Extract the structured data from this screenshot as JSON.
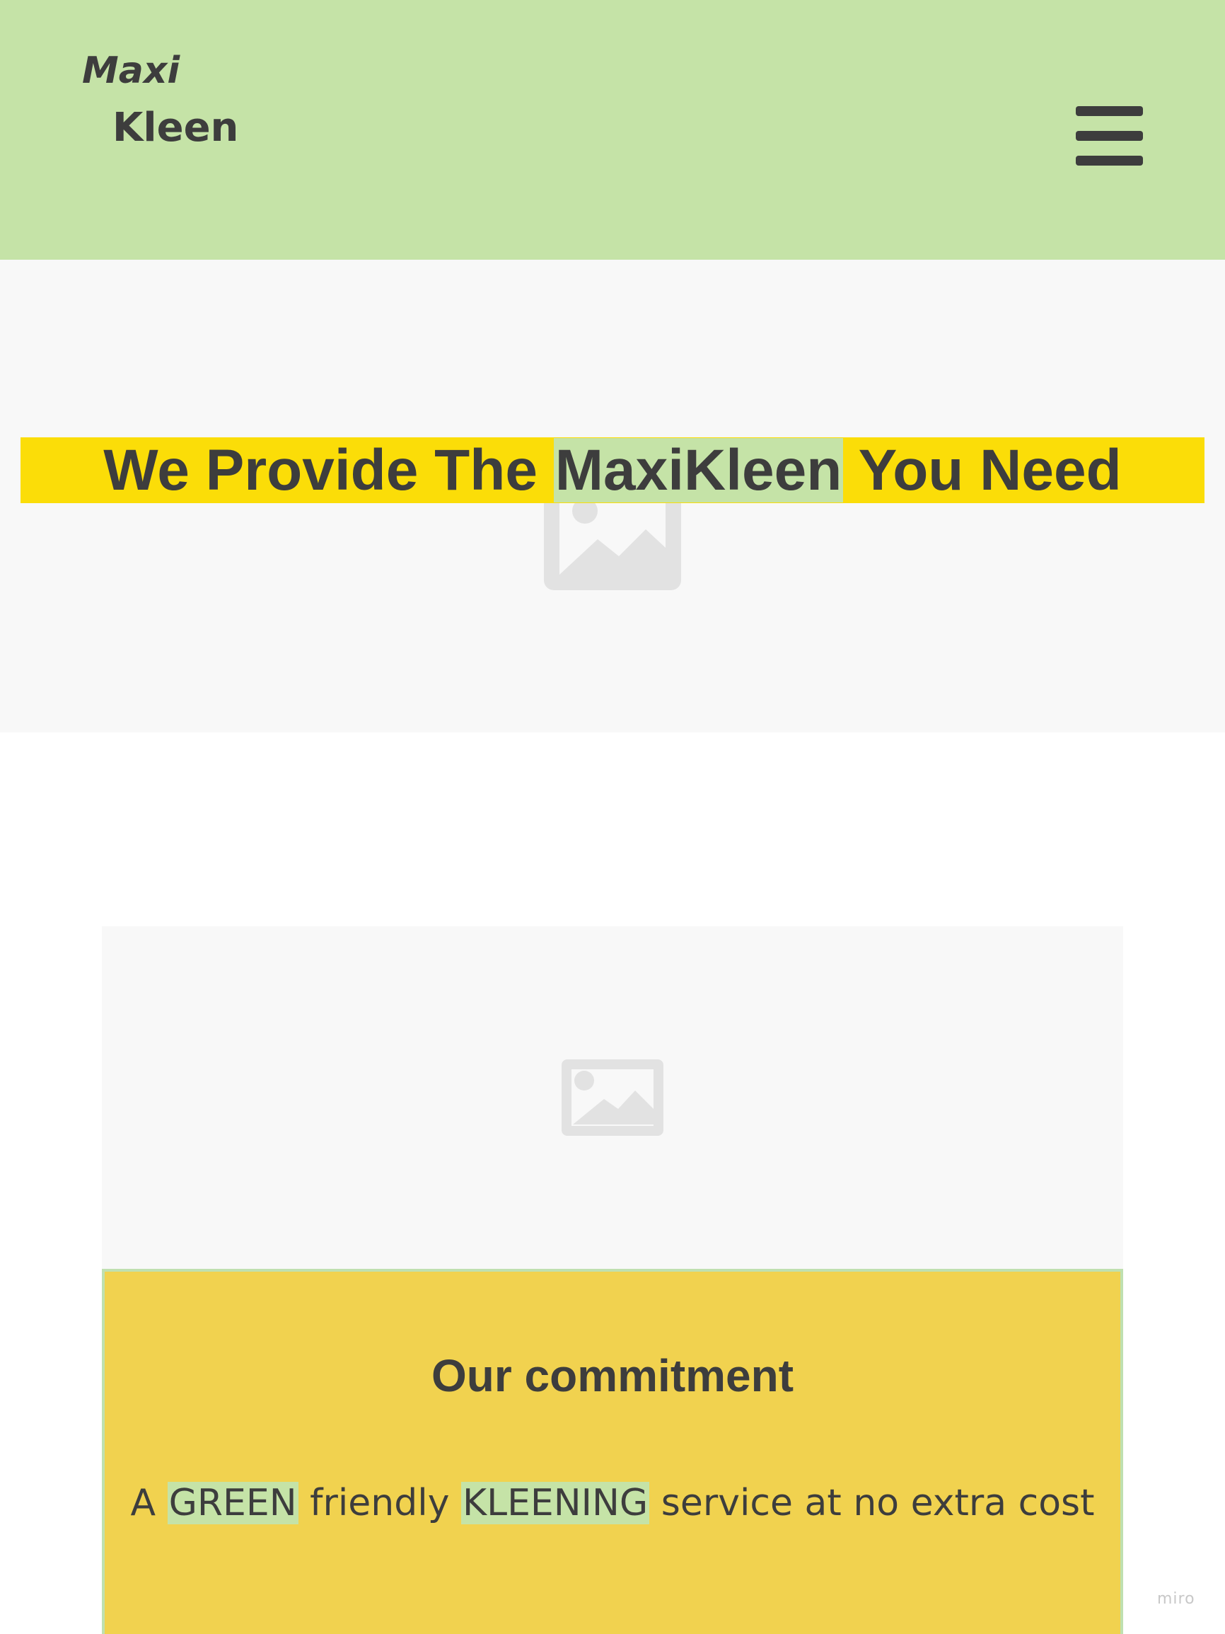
{
  "header": {
    "logo_line1": "Maxi",
    "logo_line2": "Kleen",
    "menu_icon": "hamburger-menu-icon",
    "background": "#c5e3a7"
  },
  "hero": {
    "title_before": "We Provide The ",
    "title_highlight": "MaxiKleen",
    "title_after": " You Need",
    "placeholder_icon": "image-placeholder-icon",
    "band_color": "#fbdd08",
    "highlight_color": "#c5e3a7"
  },
  "photo": {
    "placeholder_icon": "image-placeholder-icon"
  },
  "commitment": {
    "title": "Our commitment",
    "text_part1": "A ",
    "text_highlight1": "GREEN",
    "text_part2": " friendly ",
    "text_highlight2": "KLEENING",
    "text_part3": " service at no extra cost",
    "background": "#f1d24f"
  },
  "watermark": "miro"
}
